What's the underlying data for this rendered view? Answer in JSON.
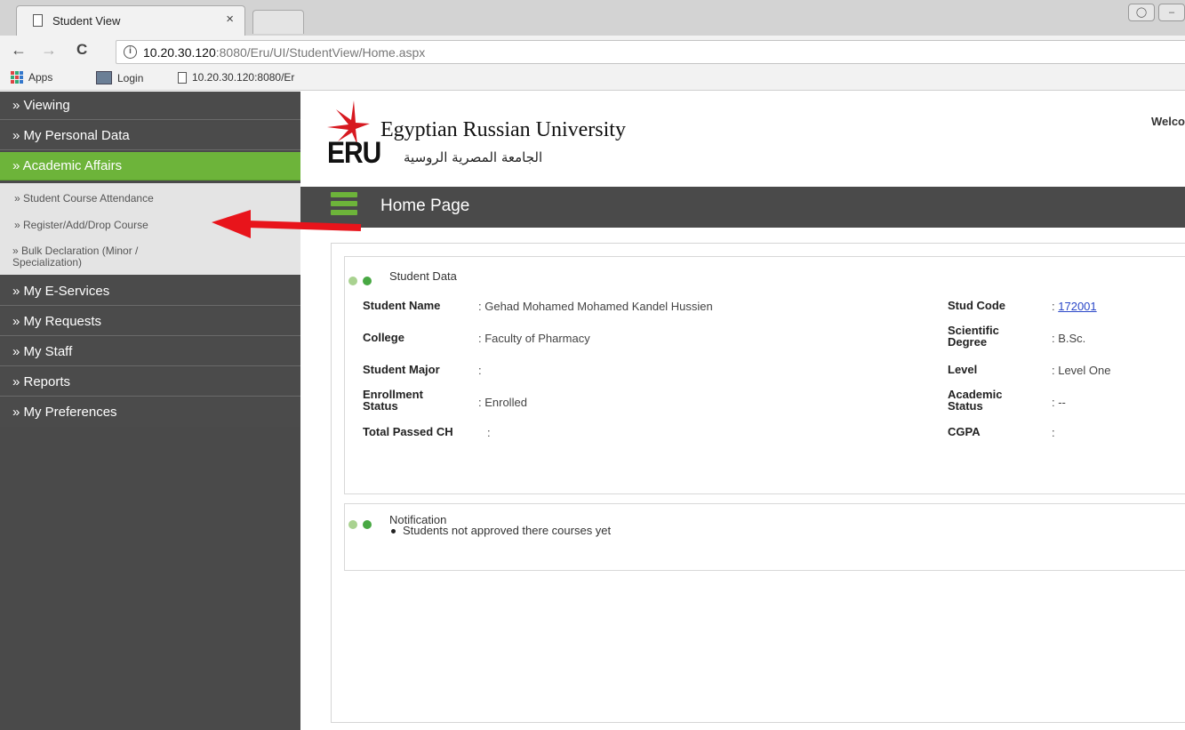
{
  "browser": {
    "tab_title": "Student View",
    "tab_close": "×",
    "url_host": "10.20.30.120",
    "url_rest": ":8080/Eru/UI/StudentView/Home.aspx",
    "info_icon": "i",
    "back_icon": "←",
    "forward_icon": "→",
    "reload_icon": "C",
    "bookmarks": [
      {
        "label": "Apps"
      },
      {
        "label": "Login"
      },
      {
        "label": "10.20.30.120:8080/Er"
      }
    ]
  },
  "sidebar": {
    "items": [
      {
        "label": "» Viewing"
      },
      {
        "label": "» My Personal Data"
      },
      {
        "label": "» Academic Affairs"
      },
      {
        "label": "» My E-Services"
      },
      {
        "label": "» My Requests"
      },
      {
        "label": "» My Staff"
      },
      {
        "label": "» Reports"
      },
      {
        "label": "» My Preferences"
      }
    ],
    "subitems": [
      {
        "label": "» Student Course Attendance"
      },
      {
        "label": "» Register/Add/Drop Course"
      },
      {
        "label_line1": "» Bulk Declaration (Minor /",
        "label_line2": "Specialization)"
      }
    ]
  },
  "header": {
    "logo_abbr": "ERU",
    "university_en": "Egyptian Russian University",
    "university_ar": "الجامعة المصرية الروسية",
    "welcome": "Welco"
  },
  "title_bar": {
    "title": "Home Page"
  },
  "student_data": {
    "title": "Student Data",
    "left": [
      {
        "label": "Student Name",
        "value": ": Gehad Mohamed Mohamed Kandel Hussien"
      },
      {
        "label": "College",
        "value": ": Faculty of Pharmacy"
      },
      {
        "label": "Student Major",
        "value": ":"
      },
      {
        "label_line1": "Enrollment",
        "label_line2": "Status",
        "value": ": Enrolled"
      },
      {
        "label": "Total Passed CH",
        "value": ":"
      }
    ],
    "right": [
      {
        "label": "Stud Code",
        "colon": ":",
        "value": "172001"
      },
      {
        "label_line1": "Scientific",
        "label_line2": "Degree",
        "value": ": B.Sc."
      },
      {
        "label": "Level",
        "value": ": Level One"
      },
      {
        "label_line1": "Academic",
        "label_line2": "Status",
        "value": ": --"
      },
      {
        "label": "CGPA",
        "value": ":"
      }
    ]
  },
  "notification": {
    "title": "Notification",
    "items": [
      "Students not approved there courses yet"
    ]
  },
  "colors": {
    "accent_green": "#6db43a",
    "sidebar_dark": "#4b4b4b",
    "annotation_red": "#e8141b",
    "link_blue": "#2a47c8"
  }
}
